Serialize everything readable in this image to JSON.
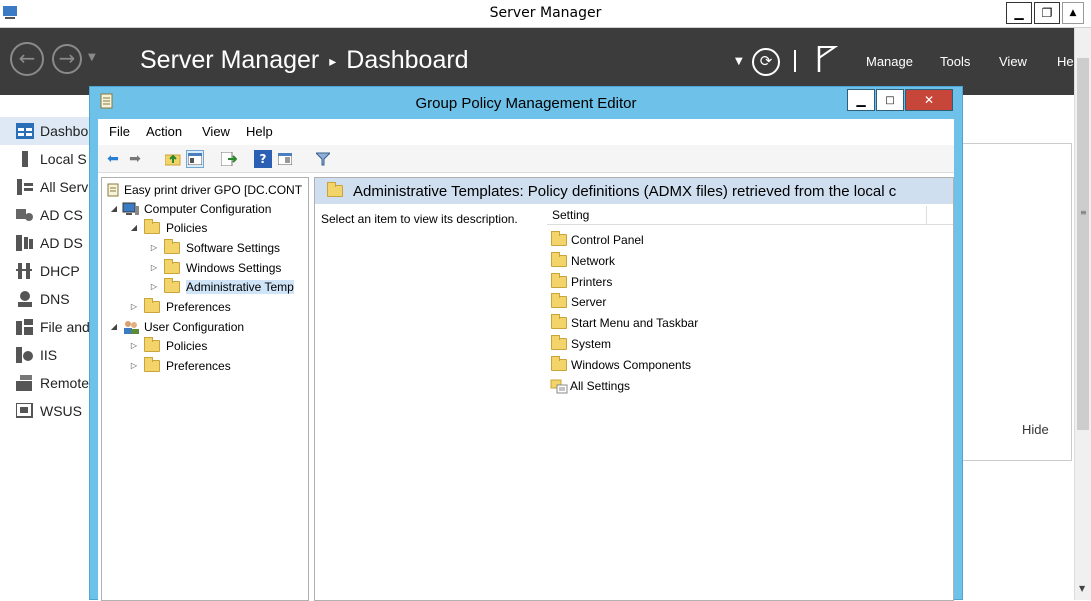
{
  "server_manager": {
    "title": "Server Manager",
    "breadcrumb_app": "Server Manager",
    "breadcrumb_page": "Dashboard",
    "menu": [
      "Manage",
      "Tools",
      "View",
      "He"
    ],
    "nav": [
      "Dashbo",
      "Local S",
      "All Serv",
      "AD CS",
      "AD DS",
      "DHCP",
      "DNS",
      "File and",
      "IIS",
      "Remote",
      "WSUS"
    ],
    "hide_label": "Hide"
  },
  "gpme": {
    "title": "Group Policy Management Editor",
    "menu": [
      "File",
      "Action",
      "View",
      "Help"
    ],
    "tree": {
      "root": "Easy print driver GPO [DC.CONT",
      "computer_config": "Computer Configuration",
      "policies": "Policies",
      "software_settings": "Software Settings",
      "windows_settings": "Windows Settings",
      "admin_templates": "Administrative Temp",
      "preferences": "Preferences",
      "user_config": "User Configuration",
      "user_policies": "Policies",
      "user_preferences": "Preferences"
    },
    "main_header": "Administrative Templates: Policy definitions (ADMX files) retrieved from the local c",
    "description": "Select an item to view its description.",
    "column_setting": "Setting",
    "items": [
      "Control Panel",
      "Network",
      "Printers",
      "Server",
      "Start Menu and Taskbar",
      "System",
      "Windows Components",
      "All Settings"
    ]
  },
  "colors": {
    "accent_window": "#6ec1e8",
    "header_dark": "#3c3c3c",
    "close_button": "#c7463a",
    "selection": "#cfe4f7"
  }
}
